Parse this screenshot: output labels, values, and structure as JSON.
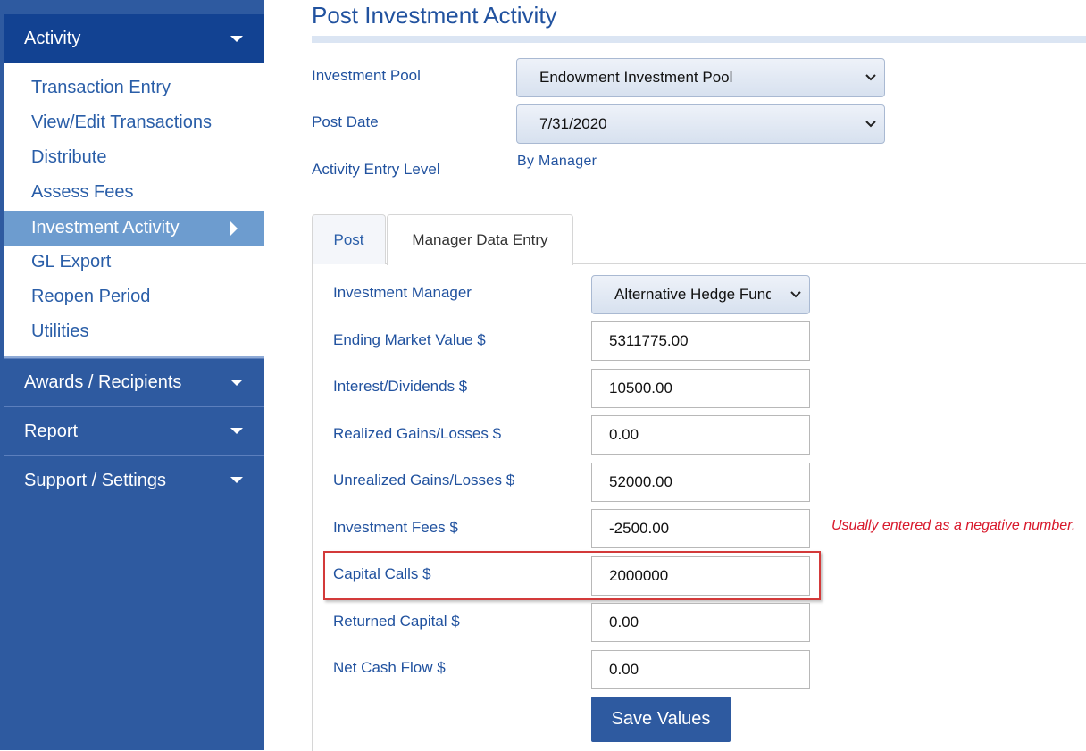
{
  "sidebar": {
    "activity": {
      "label": "Activity"
    },
    "activity_items": [
      {
        "label": "Transaction Entry"
      },
      {
        "label": "View/Edit Transactions"
      },
      {
        "label": "Distribute"
      },
      {
        "label": "Assess Fees"
      },
      {
        "label": "Investment Activity",
        "active": true
      },
      {
        "label": "GL Export"
      },
      {
        "label": "Reopen Period"
      },
      {
        "label": "Utilities"
      }
    ],
    "awards": {
      "label": "Awards / Recipients"
    },
    "report": {
      "label": "Report"
    },
    "support": {
      "label": "Support / Settings"
    }
  },
  "page": {
    "title": "Post Investment Activity",
    "investment_pool": {
      "label": "Investment Pool",
      "value": "Endowment Investment Pool"
    },
    "post_date": {
      "label": "Post Date",
      "value": "7/31/2020"
    },
    "entry_level": {
      "label": "Activity Entry Level",
      "value": "By Manager"
    }
  },
  "tabs": {
    "post": "Post",
    "manager_data_entry": "Manager Data Entry"
  },
  "form": {
    "investment_manager": {
      "label": "Investment Manager",
      "value": "Alternative Hedge Fund"
    },
    "fields": [
      {
        "label": "Ending Market Value $",
        "value": "5311775.00"
      },
      {
        "label": "Interest/Dividends $",
        "value": "10500.00"
      },
      {
        "label": "Realized Gains/Losses $",
        "value": "0.00"
      },
      {
        "label": "Unrealized Gains/Losses $",
        "value": "52000.00"
      },
      {
        "label": "Investment Fees $",
        "value": "-2500.00"
      },
      {
        "label": "Capital Calls $",
        "value": "2000000"
      },
      {
        "label": "Returned Capital $",
        "value": "0.00"
      },
      {
        "label": "Net Cash Flow $",
        "value": "0.00"
      }
    ],
    "fees_hint": "Usually entered as a negative number.",
    "save_label": "Save Values"
  },
  "colors": {
    "sidebar_bg": "#2e5aa0",
    "sidebar_active_header": "#124292",
    "active_item": "#6d9ccf",
    "link_text": "#2a5ea8",
    "hint_red": "#d8182b",
    "highlight_border": "#d33a3a"
  }
}
